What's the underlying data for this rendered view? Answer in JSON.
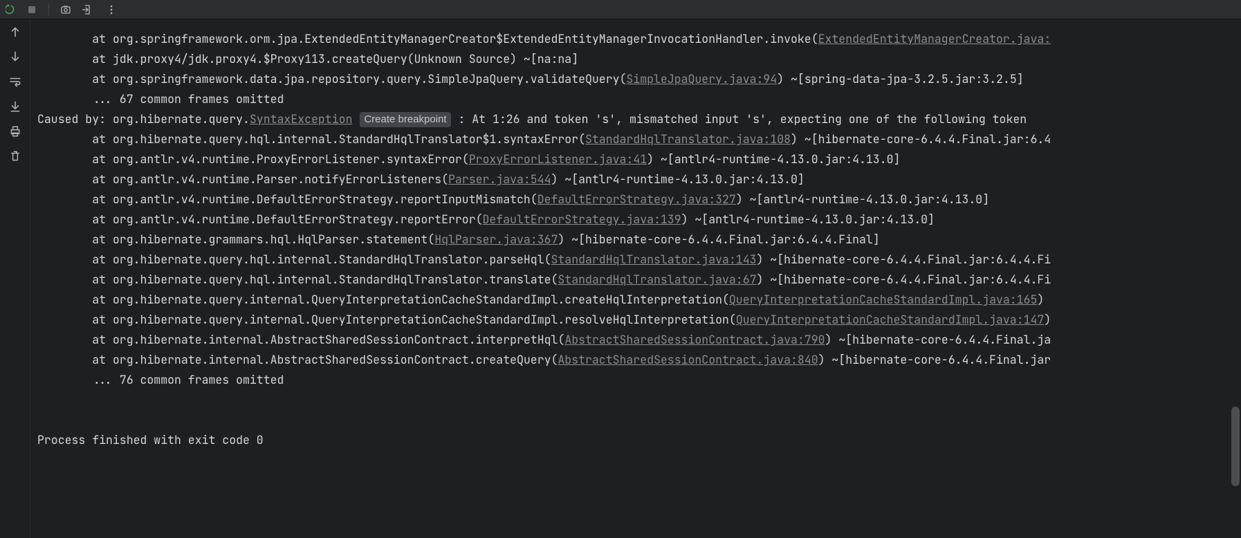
{
  "toolbar": {
    "icons": [
      "rerun",
      "stop",
      "screenshot",
      "exit",
      "more"
    ]
  },
  "gutter": {
    "icons": [
      "arrow-up",
      "arrow-down",
      "wrap",
      "scroll-to-end",
      "print",
      "trash"
    ]
  },
  "console": {
    "lines": [
      {
        "indent": "        ",
        "prefix": "at ",
        "text1": "org.springframework.orm.jpa.ExtendedEntityManagerCreator$ExtendedEntityManagerInvocationHandler.invoke(",
        "link": "ExtendedEntityManagerCreator.java:",
        "text2": ""
      },
      {
        "indent": "        ",
        "prefix": "at ",
        "text1": "jdk.proxy4/jdk.proxy4.$Proxy113.createQuery(Unknown Source) ~[na:na]",
        "link": "",
        "text2": ""
      },
      {
        "indent": "        ",
        "prefix": "at ",
        "text1": "org.springframework.data.jpa.repository.query.SimpleJpaQuery.validateQuery(",
        "link": "SimpleJpaQuery.java:94",
        "text2": ") ~[spring-data-jpa-3.2.5.jar:3.2.5]"
      },
      {
        "indent": "        ",
        "prefix": "",
        "text1": "... 67 common frames omitted",
        "link": "",
        "text2": ""
      },
      {
        "indent": "",
        "prefix": "Caused by: ",
        "text1": "org.hibernate.query.",
        "link": "SyntaxException",
        "badge": "Create breakpoint",
        "text2": ": At 1:26 and token 's', mismatched input 's', expecting one of the following token"
      },
      {
        "indent": "        ",
        "prefix": "at ",
        "text1": "org.hibernate.query.hql.internal.StandardHqlTranslator$1.syntaxError(",
        "link": "StandardHqlTranslator.java:108",
        "text2": ") ~[hibernate-core-6.4.4.Final.jar:6.4"
      },
      {
        "indent": "        ",
        "prefix": "at ",
        "text1": "org.antlr.v4.runtime.ProxyErrorListener.syntaxError(",
        "link": "ProxyErrorListener.java:41",
        "text2": ") ~[antlr4-runtime-4.13.0.jar:4.13.0]"
      },
      {
        "indent": "        ",
        "prefix": "at ",
        "text1": "org.antlr.v4.runtime.Parser.notifyErrorListeners(",
        "link": "Parser.java:544",
        "text2": ") ~[antlr4-runtime-4.13.0.jar:4.13.0]"
      },
      {
        "indent": "        ",
        "prefix": "at ",
        "text1": "org.antlr.v4.runtime.DefaultErrorStrategy.reportInputMismatch(",
        "link": "DefaultErrorStrategy.java:327",
        "text2": ") ~[antlr4-runtime-4.13.0.jar:4.13.0]"
      },
      {
        "indent": "        ",
        "prefix": "at ",
        "text1": "org.antlr.v4.runtime.DefaultErrorStrategy.reportError(",
        "link": "DefaultErrorStrategy.java:139",
        "text2": ") ~[antlr4-runtime-4.13.0.jar:4.13.0]"
      },
      {
        "indent": "        ",
        "prefix": "at ",
        "text1": "org.hibernate.grammars.hql.HqlParser.statement(",
        "link": "HqlParser.java:367",
        "text2": ") ~[hibernate-core-6.4.4.Final.jar:6.4.4.Final]"
      },
      {
        "indent": "        ",
        "prefix": "at ",
        "text1": "org.hibernate.query.hql.internal.StandardHqlTranslator.parseHql(",
        "link": "StandardHqlTranslator.java:143",
        "text2": ") ~[hibernate-core-6.4.4.Final.jar:6.4.4.Fi"
      },
      {
        "indent": "        ",
        "prefix": "at ",
        "text1": "org.hibernate.query.hql.internal.StandardHqlTranslator.translate(",
        "link": "StandardHqlTranslator.java:67",
        "text2": ") ~[hibernate-core-6.4.4.Final.jar:6.4.4.Fi"
      },
      {
        "indent": "        ",
        "prefix": "at ",
        "text1": "org.hibernate.query.internal.QueryInterpretationCacheStandardImpl.createHqlInterpretation(",
        "link": "QueryInterpretationCacheStandardImpl.java:165",
        "text2": ")"
      },
      {
        "indent": "        ",
        "prefix": "at ",
        "text1": "org.hibernate.query.internal.QueryInterpretationCacheStandardImpl.resolveHqlInterpretation(",
        "link": "QueryInterpretationCacheStandardImpl.java:147",
        "text2": ")"
      },
      {
        "indent": "        ",
        "prefix": "at ",
        "text1": "org.hibernate.internal.AbstractSharedSessionContract.interpretHql(",
        "link": "AbstractSharedSessionContract.java:790",
        "text2": ") ~[hibernate-core-6.4.4.Final.ja"
      },
      {
        "indent": "        ",
        "prefix": "at ",
        "text1": "org.hibernate.internal.AbstractSharedSessionContract.createQuery(",
        "link": "AbstractSharedSessionContract.java:840",
        "text2": ") ~[hibernate-core-6.4.4.Final.jar"
      },
      {
        "indent": "        ",
        "prefix": "",
        "text1": "... 76 common frames omitted",
        "link": "",
        "text2": ""
      },
      {
        "blank": true
      },
      {
        "blank": true
      },
      {
        "indent": "",
        "prefix": "",
        "text1": "Process finished with exit code 0",
        "link": "",
        "text2": ""
      }
    ]
  }
}
